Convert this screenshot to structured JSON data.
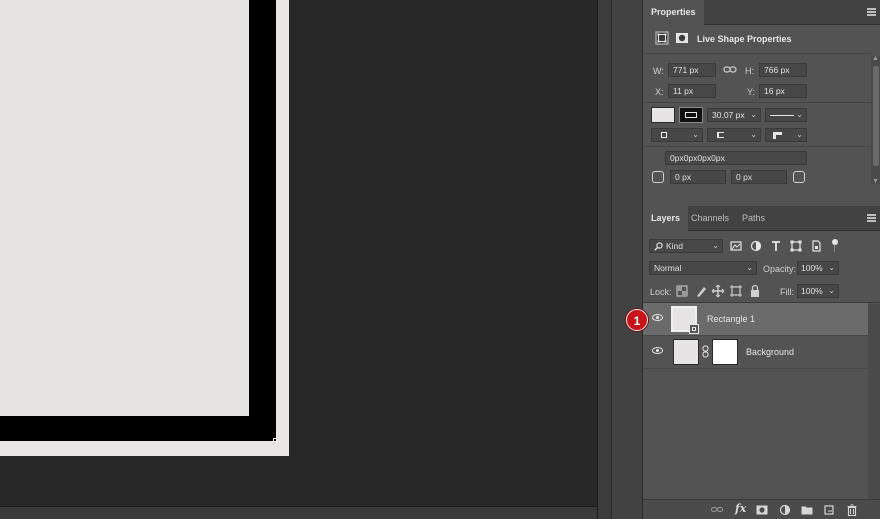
{
  "properties": {
    "tab_label": "Properties",
    "subtitle": "Live Shape Properties",
    "w_label": "W:",
    "w_value": "771 px",
    "h_label": "H:",
    "h_value": "766 px",
    "x_label": "X:",
    "x_value": "11 px",
    "y_label": "Y:",
    "y_value": "16 px",
    "stroke_width": "30.07 px",
    "corner_radii": "0px0px0px0px",
    "radius_left": "0 px",
    "radius_right": "0 px"
  },
  "layers": {
    "tabs": [
      "Layers",
      "Channels",
      "Paths"
    ],
    "filter_label": "Kind",
    "blend_mode": "Normal",
    "opacity_label": "Opacity:",
    "opacity_value": "100%",
    "lock_label": "Lock:",
    "fill_label": "Fill:",
    "fill_value": "100%",
    "items": [
      {
        "name": "Rectangle 1",
        "selected": true
      },
      {
        "name": "Background",
        "selected": false
      }
    ]
  },
  "callout_number": "1",
  "colors": {
    "panel_bg": "#535353",
    "canvas_bg": "#282828",
    "selected_row": "#6b6b6b",
    "callout": "#c8131b"
  },
  "icons": [
    "menu-icon",
    "eye-icon",
    "link-icon",
    "lock-icon",
    "search-icon",
    "fx-icon",
    "mask-icon",
    "adjustment-icon",
    "folder-icon",
    "new-layer-icon",
    "trash-icon"
  ]
}
